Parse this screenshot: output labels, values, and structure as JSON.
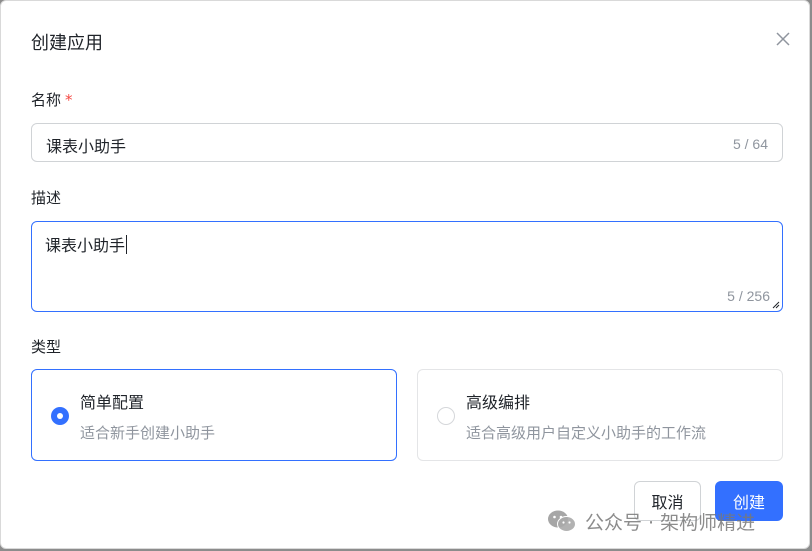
{
  "dialog": {
    "title": "创建应用",
    "close_icon": "close-icon"
  },
  "name_field": {
    "label": "名称",
    "required_mark": "*",
    "value": "课表小助手",
    "counter": "5 / 64"
  },
  "description_field": {
    "label": "描述",
    "value": "课表小助手",
    "counter": "5 / 256",
    "resize_icon": "resize-handle-icon"
  },
  "type_field": {
    "label": "类型",
    "options": [
      {
        "title": "简单配置",
        "description": "适合新手创建小助手",
        "selected": true
      },
      {
        "title": "高级编排",
        "description": "适合高级用户自定义小助手的工作流",
        "selected": false
      }
    ]
  },
  "footer": {
    "cancel_label": "取消",
    "create_label": "创建"
  },
  "watermark": {
    "text": "公众号 · 架构师精进",
    "icon": "wechat-icon"
  },
  "colors": {
    "primary": "#3370ff",
    "required": "#f54a45",
    "muted_text": "#8f959e"
  }
}
